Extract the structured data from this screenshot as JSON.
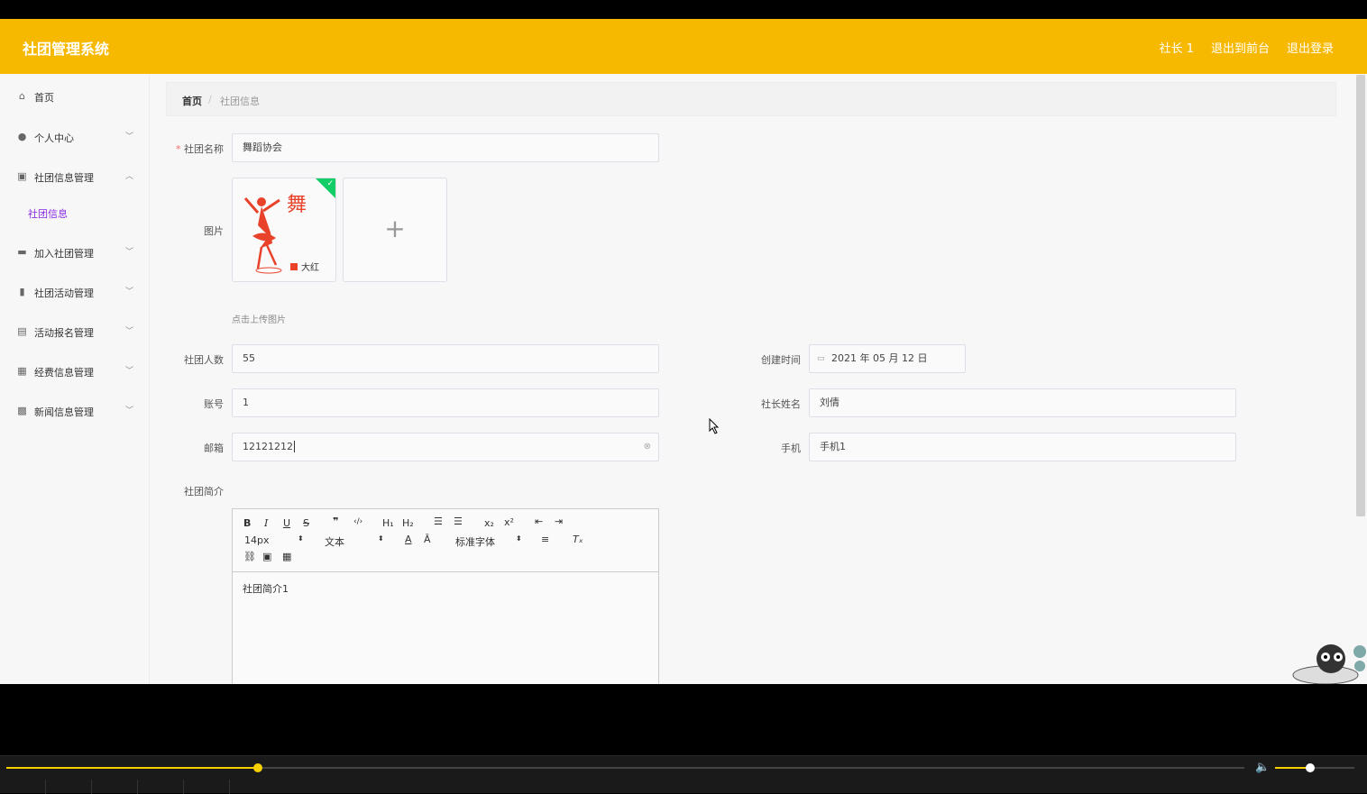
{
  "topbar": {
    "brand": "社团管理系统",
    "links": [
      "社长 1",
      "退出到前台",
      "退出登录"
    ],
    "color": "#f7b900"
  },
  "sidebar": {
    "items": [
      {
        "label": "首页",
        "icon": "home-icon",
        "expanded": false
      },
      {
        "label": "个人中心",
        "icon": "user-icon",
        "expanded": false
      },
      {
        "label": "社团信息管理",
        "icon": "clipboard-icon",
        "expanded": true
      },
      {
        "label": "加入社团管理",
        "icon": "monitor-icon",
        "expanded": false
      },
      {
        "label": "社团活动管理",
        "icon": "bar-chart-icon",
        "expanded": false
      },
      {
        "label": "活动报名管理",
        "icon": "document-icon",
        "expanded": false
      },
      {
        "label": "经费信息管理",
        "icon": "briefcase-icon",
        "expanded": false
      },
      {
        "label": "新闻信息管理",
        "icon": "grid-icon",
        "expanded": false
      }
    ],
    "submenu_active": "社团信息",
    "active_color": "#8a2be2"
  },
  "breadcrumb": {
    "home": "首页",
    "separator": "/",
    "current": "社团信息"
  },
  "form": {
    "club_name": {
      "label": "社团名称",
      "value": "舞蹈协会",
      "required": true
    },
    "image": {
      "label": "图片",
      "hint": "点击上传图片",
      "thumb_caption": "大红",
      "thumb_brand": "舞"
    },
    "members": {
      "label": "社团人数",
      "value": "55"
    },
    "created": {
      "label": "创建时间",
      "value": "2021 年 05 月 12 日"
    },
    "account": {
      "label": "账号",
      "value": "1"
    },
    "leader": {
      "label": "社长姓名",
      "value": "刘倩"
    },
    "email": {
      "label": "邮箱",
      "value": "12121212"
    },
    "phone": {
      "label": "手机",
      "value": "手机1"
    },
    "intro": {
      "label": "社团简介",
      "value": "社团简介1"
    }
  },
  "editor": {
    "font_size": "14px",
    "block_type": "文本",
    "font_family": "标准字体"
  },
  "player": {
    "progress": 0.203,
    "volume": 0.44
  }
}
